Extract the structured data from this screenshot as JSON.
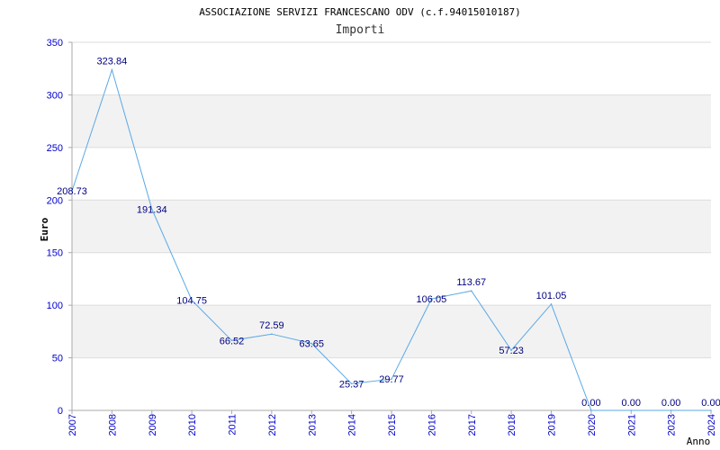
{
  "chart_data": {
    "type": "line",
    "title": "ASSOCIAZIONE SERVIZI FRANCESCANO ODV (c.f.94015010187)",
    "subtitle": "Importi",
    "xlabel": "Anno",
    "ylabel": "Euro",
    "categories": [
      "2007",
      "2008",
      "2009",
      "2010",
      "2011",
      "2012",
      "2013",
      "2014",
      "2015",
      "2016",
      "2017",
      "2018",
      "2019",
      "2020",
      "2021",
      "2022",
      "2023",
      "2024"
    ],
    "tick_labels": [
      "2007",
      "2008",
      "2009",
      "2010",
      "2011",
      "2012",
      "2013",
      "2014",
      "2015",
      "2016",
      "2017",
      "2018",
      "2019",
      "2020",
      "2021",
      "2023",
      "2024"
    ],
    "series": [
      {
        "values": [
          208.73,
          323.84,
          191.34,
          104.75,
          66.52,
          72.59,
          63.65,
          25.37,
          29.77,
          106.05,
          113.67,
          57.23,
          101.05,
          0,
          0,
          0,
          0
        ],
        "data_labels": [
          "208.73",
          "323.84",
          "191.34",
          "104.75",
          "66.52",
          "72.59",
          "63.65",
          "25.37",
          "29.77",
          "106.05",
          "113.67",
          "57.23",
          "101.05",
          "0.00",
          "0.00",
          "0.00",
          "0.00"
        ]
      }
    ],
    "ylim": [
      0,
      350
    ],
    "yticks": [
      0,
      50,
      100,
      150,
      200,
      250,
      300,
      350
    ],
    "grid": true,
    "colors": {
      "line": "#5aa9e6",
      "band": "#f2f2f2",
      "gridline": "#dddddd",
      "axis": "#aaaaaa",
      "tick_text": "#0000cc",
      "label_text": "#000080"
    }
  }
}
